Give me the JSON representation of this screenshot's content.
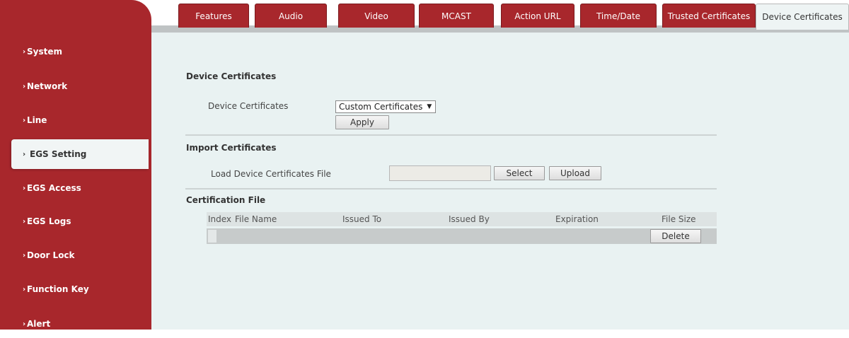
{
  "sidebar": {
    "items": [
      {
        "label": "System",
        "active": false
      },
      {
        "label": "Network",
        "active": false
      },
      {
        "label": "Line",
        "active": false
      },
      {
        "label": "EGS Setting",
        "active": true
      },
      {
        "label": "EGS Access",
        "active": false
      },
      {
        "label": "EGS Logs",
        "active": false
      },
      {
        "label": "Door Lock",
        "active": false
      },
      {
        "label": "Function Key",
        "active": false
      },
      {
        "label": "Alert",
        "active": false
      }
    ],
    "chevron": "›"
  },
  "tabs": [
    {
      "label": "Features",
      "active": false
    },
    {
      "label": "Audio",
      "active": false
    },
    {
      "label": "Video",
      "active": false
    },
    {
      "label": "MCAST",
      "active": false
    },
    {
      "label": "Action URL",
      "active": false
    },
    {
      "label": "Time/Date",
      "active": false
    },
    {
      "label": "Trusted Certificates",
      "active": false
    },
    {
      "label": "Device Certificates",
      "active": true
    }
  ],
  "device_certificates": {
    "title": "Device Certificates",
    "field_label": "Device Certificates",
    "select_value": "Custom Certificates",
    "select_arrow": "▼",
    "apply_label": "Apply"
  },
  "import_certificates": {
    "title": "Import Certificates",
    "field_label": "Load Device Certificates File",
    "file_value": "",
    "select_label": "Select",
    "upload_label": "Upload"
  },
  "certification_file": {
    "title": "Certification File",
    "columns": [
      "Index",
      "File Name",
      "Issued To",
      "Issued By",
      "Expiration",
      "File Size"
    ],
    "delete_label": "Delete"
  },
  "colors": {
    "brand_red": "#a8272c",
    "content_bg": "#e9f2f2"
  }
}
